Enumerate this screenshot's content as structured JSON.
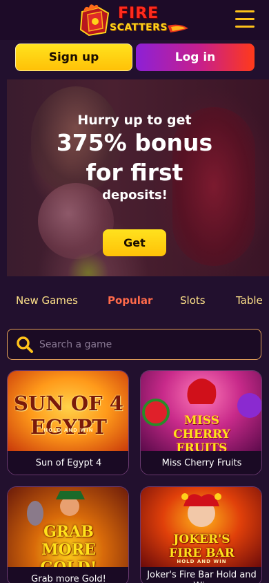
{
  "header": {
    "logo_top": "FIRE",
    "logo_bottom": "SCATTERS",
    "menu_icon": "hamburger-icon"
  },
  "auth": {
    "signup_label": "Sign up",
    "login_label": "Log in"
  },
  "banner": {
    "line1": "Hurry up to get",
    "line2": "375% bonus",
    "line3": "for first",
    "line4": "deposits!",
    "cta_label": "Get"
  },
  "tabs": [
    {
      "label": "New Games",
      "active": false
    },
    {
      "label": "Popular",
      "active": true
    },
    {
      "label": "Slots",
      "active": false
    },
    {
      "label": "Table",
      "active": false
    }
  ],
  "search": {
    "placeholder": "Search a game",
    "icon": "search-icon"
  },
  "games": [
    {
      "name": "Sun of Egypt 4",
      "art_title": "SUN OF 4 EGYPT",
      "art_sub": "HOLD AND WIN"
    },
    {
      "name": "Miss Cherry Fruits",
      "art_title": "MISS CHERRY FRUITS"
    },
    {
      "name": "Grab more Gold!",
      "art_title": "GRAB MORE GOLD!"
    },
    {
      "name": "Joker's Fire Bar Hold and Win",
      "art_title": "JOKER'S FIRE BAR",
      "art_sub": "HOLD AND WIN"
    }
  ],
  "colors": {
    "background": "#22102e",
    "accent_yellow": "#ffd21a",
    "accent_red": "#ff2a1c",
    "tab_active": "#ff6a4a",
    "tab_inactive": "#ffe28a"
  }
}
